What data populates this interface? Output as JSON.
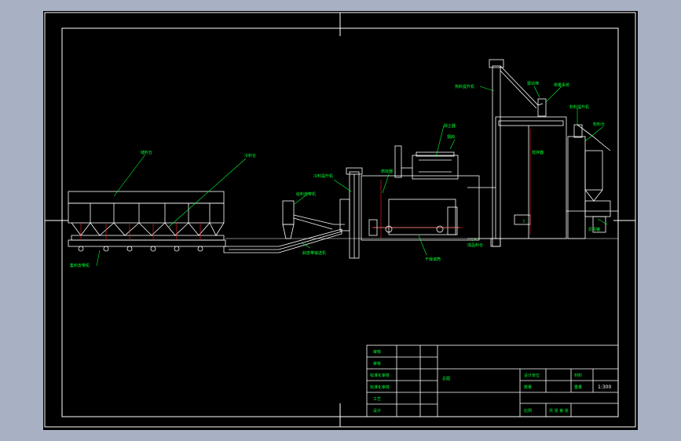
{
  "title_block": {
    "left_rows": [
      "审核",
      "审核",
      "标准化审核",
      "标准化审核",
      "工艺",
      "设计"
    ],
    "drawing_name": "总图",
    "design_label": "设计单位",
    "quantity_label": "数量",
    "scale_label": "比例",
    "scale_value": "1:300",
    "sheet_label": "共 张 第 张",
    "material_label": "材料",
    "weight_label": "重量"
  },
  "annotations": {
    "feed_hopper": "冷料仓",
    "belt_conveyor_1": "集料皮带机",
    "belt_feeder": "给料皮带机",
    "inclined_belt": "斜皮带输送机",
    "dryer": "干燥滚筒",
    "hot_elevator": "热料提升机",
    "screen": "振动筛",
    "burner": "燃烧器",
    "dust_collector": "除尘器",
    "mixer": "搅拌器",
    "finished_bin": "成品料仓",
    "powder_elevator": "粉料提升机",
    "powder_silo": "粉料仓",
    "asphalt_tank": "沥青罐",
    "weighing": "称量系统",
    "cold_elevator": "冷料提升机",
    "control_room": "控制室",
    "storage_bin": "储料仓",
    "fan": "引风机",
    "chimney": "烟囱"
  },
  "colors": {
    "background": "#000000",
    "frame": "#ffffff",
    "label": "#00ff33",
    "leader": "#00ff33",
    "centerline": "#ff2020",
    "geometry": "#ffffff"
  }
}
